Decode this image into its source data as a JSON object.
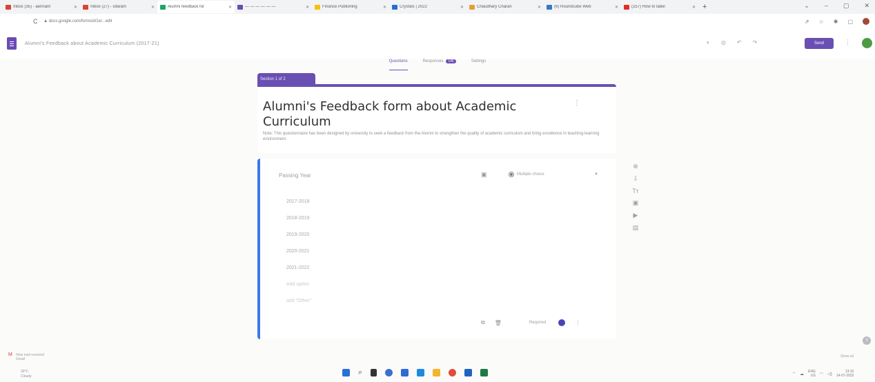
{
  "browser": {
    "tabs": [
      {
        "title": "Inbox (35) - aennant",
        "color": "#d44638"
      },
      {
        "title": "Inbox (27) - sitaram",
        "color": "#d44638"
      },
      {
        "title": "Alumni feedback for",
        "color": "#1fa463"
      },
      {
        "title": "— — — — — —",
        "color": "#6a4bb6"
      },
      {
        "title": "Finance Publishing",
        "color": "#f4c20d"
      },
      {
        "title": "Crystals | 2022",
        "color": "#2b6cd4"
      },
      {
        "title": "Chaudhary Charan",
        "color": "#e0a23c"
      },
      {
        "title": "(6) Roundcube Web",
        "color": "#3778c2"
      },
      {
        "title": "(257) How to label",
        "color": "#e52d27"
      }
    ],
    "new_tab": "+",
    "window_controls": [
      "⌄",
      "–",
      "▢",
      "✕"
    ],
    "url": "docs.google.com/forms/d/1e/...edit",
    "reload": "C",
    "address_icons": [
      "⇗",
      "☆",
      "✱",
      "▢"
    ]
  },
  "forms_header": {
    "doc_title": "Alumni's Feedback about Academic Curriculum (2017-21)",
    "icons": [
      "◐",
      "◎",
      "↶",
      "↷"
    ],
    "send_label": "Send",
    "more": "⋮"
  },
  "subtabs": {
    "questions": "Questions",
    "responses": "Responses",
    "responses_count": "145",
    "settings": "Settings"
  },
  "section_label": "Section 1 of 2",
  "form": {
    "title": "Alumni's Feedback form about Academic Curriculum",
    "description": "Note: This questionnaire has been designed by university to seek a feedback from the Alumni to strengthen the quality of academic curriculum and bring excellence in teaching-learning environment.",
    "more": "⋮"
  },
  "question": {
    "title": "Passing Year",
    "type": "Multiple choice",
    "options": [
      "2017-2018",
      "2018-2019",
      "2019-2020",
      "2020-2021",
      "2021-2022"
    ],
    "faded_options": [
      "Add option",
      "add \"Other\""
    ],
    "required_label": "Required",
    "more": "⋮"
  },
  "side_tools": [
    "⊕",
    "⇩",
    "Tт",
    "▣",
    "▶",
    "▤"
  ],
  "notifications": {
    "gmail_line1": "New mail received",
    "gmail_line2": "Gmail",
    "weather_temp": "30°C",
    "weather_desc": "Cloudy",
    "right": "Show all"
  },
  "tray": {
    "language_top": "ENG",
    "language_bottom": "US",
    "time": "13:10",
    "date": "14-07-2022"
  },
  "colors": {
    "accent": "#6a4fb3",
    "question_border": "#3b78e7"
  }
}
